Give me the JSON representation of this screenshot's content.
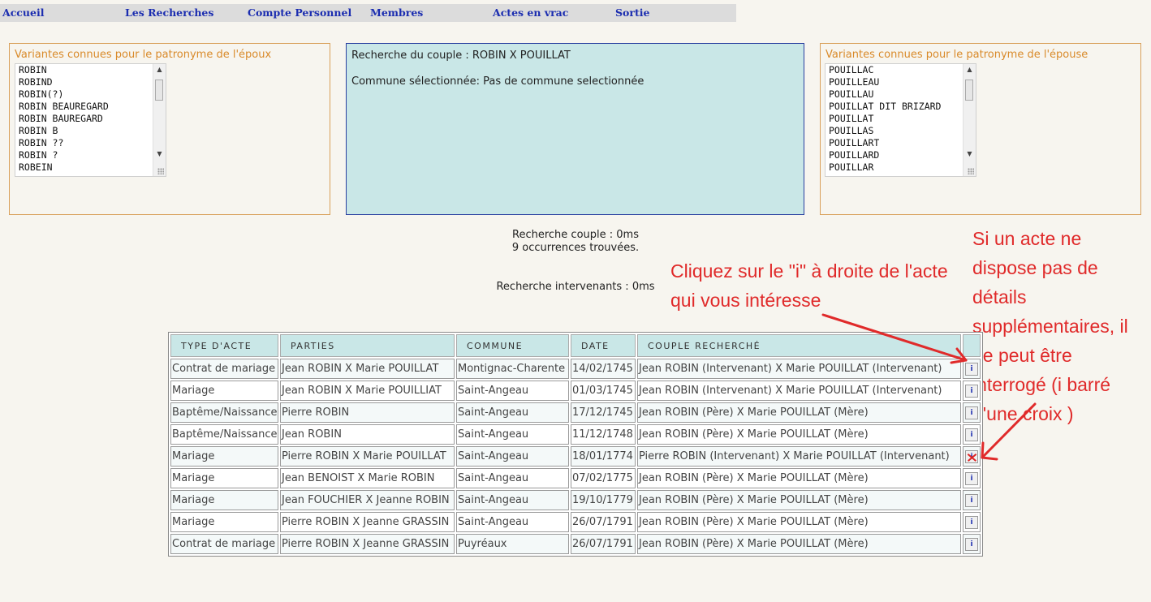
{
  "nav": [
    {
      "label": "Accueil"
    },
    {
      "label": "Les Recherches"
    },
    {
      "label": "Compte Personnel"
    },
    {
      "label": "Membres"
    },
    {
      "label": "Actes en vrac"
    },
    {
      "label": "Sortie"
    }
  ],
  "husband_variants": {
    "title": "Variantes connues pour le patronyme de l'époux",
    "options": [
      "ROBIN",
      "ROBIND",
      "ROBIN(?)",
      "ROBIN BEAUREGARD",
      "ROBIN BAUREGARD",
      "ROBIN B",
      "ROBIN ??",
      "ROBIN ?",
      "ROBEIN"
    ]
  },
  "wife_variants": {
    "title": "Variantes connues pour le patronyme de l'épouse",
    "options": [
      "POUILLAC",
      "POUILLEAU",
      "POUILLAU",
      "POUILLAT DIT BRIZARD",
      "POUILLAT",
      "POUILLAS",
      "POUILLART",
      "POUILLARD",
      "POUILLAR"
    ]
  },
  "search": {
    "couple_line": "Recherche du couple : ROBIN X POUILLAT",
    "commune_line": "Commune sélectionnée: Pas de commune selectionnée"
  },
  "status": {
    "couple_time": "Recherche couple : 0ms",
    "occurrences": "9 occurrences trouvées.",
    "intervenants_time": "Recherche intervenants : 0ms"
  },
  "annotations": {
    "left": "Cliquez sur le \"i\" à droite de l'acte qui vous intéresse",
    "right": "Si un acte ne dispose pas de détails supplémentaires, il ne peut être interrogé (i barré d'une    croix )"
  },
  "results": {
    "headers": [
      "TYPE D'ACTE",
      "PARTIES",
      "COMMUNE",
      "DATE",
      "COUPLE RECHERCHÉ"
    ],
    "info_label": "i",
    "rows": [
      {
        "type": "Contrat de mariage",
        "parties": "Jean ROBIN X Marie POUILLAT",
        "commune": "Montignac-Charente",
        "date": "14/02/1745",
        "couple": "Jean ROBIN (Intervenant) X Marie POUILLAT (Intervenant)",
        "details": true
      },
      {
        "type": "Mariage",
        "parties": "Jean ROBIN X Marie POUILLIAT",
        "commune": "Saint-Angeau",
        "date": "01/03/1745",
        "couple": "Jean ROBIN (Intervenant) X Marie POUILLAT (Intervenant)",
        "details": true
      },
      {
        "type": "Baptême/Naissance",
        "parties": "Pierre ROBIN",
        "commune": "Saint-Angeau",
        "date": "17/12/1745",
        "couple": "Jean ROBIN (Père) X Marie POUILLAT (Mère)",
        "details": true
      },
      {
        "type": "Baptême/Naissance",
        "parties": "Jean ROBIN",
        "commune": "Saint-Angeau",
        "date": "11/12/1748",
        "couple": "Jean ROBIN (Père) X Marie POUILLAT (Mère)",
        "details": true
      },
      {
        "type": "Mariage",
        "parties": "Pierre ROBIN X Marie POUILLAT",
        "commune": "Saint-Angeau",
        "date": "18/01/1774",
        "couple": "Pierre ROBIN (Intervenant) X Marie POUILLAT (Intervenant)",
        "details": false
      },
      {
        "type": "Mariage",
        "parties": "Jean BENOIST X Marie ROBIN",
        "commune": "Saint-Angeau",
        "date": "07/02/1775",
        "couple": "Jean ROBIN (Père) X Marie POUILLAT (Mère)",
        "details": true
      },
      {
        "type": "Mariage",
        "parties": "Jean FOUCHIER X Jeanne ROBIN",
        "commune": "Saint-Angeau",
        "date": "19/10/1779",
        "couple": "Jean ROBIN (Père) X Marie POUILLAT (Mère)",
        "details": true
      },
      {
        "type": "Mariage",
        "parties": "Pierre ROBIN X Jeanne GRASSIN",
        "commune": "Saint-Angeau",
        "date": "26/07/1791",
        "couple": "Jean ROBIN (Père) X Marie POUILLAT (Mère)",
        "details": true
      },
      {
        "type": "Contrat de mariage",
        "parties": "Pierre ROBIN X Jeanne GRASSIN",
        "commune": "Puyréaux",
        "date": "26/07/1791",
        "couple": "Jean ROBIN (Père) X Marie POUILLAT (Mère)",
        "details": true
      }
    ]
  },
  "colors": {
    "accent_blue": "#1b2db0",
    "panel_teal": "#c9e7e7",
    "variant_orange": "#d98a2a",
    "annotation_red": "#e02a2a"
  }
}
